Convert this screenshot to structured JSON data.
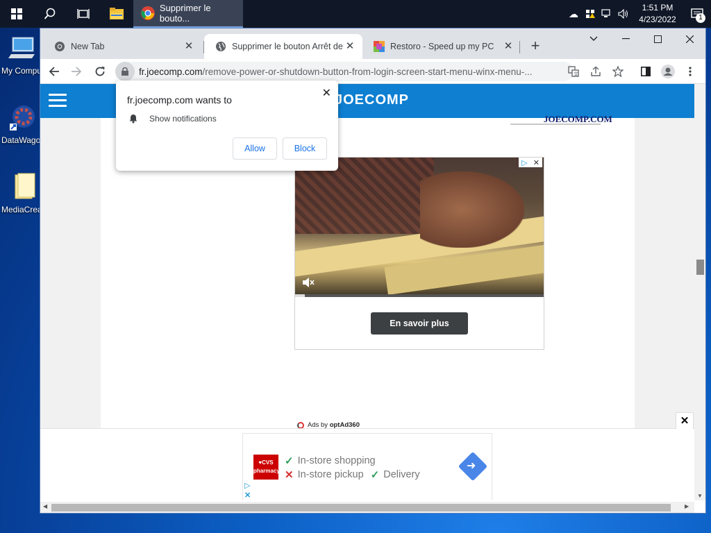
{
  "taskbar": {
    "active_app_title": "Supprimer le bouto...",
    "clock_time": "1:51 PM",
    "clock_date": "4/23/2022",
    "notification_count": "1"
  },
  "desktop": {
    "icons": [
      {
        "label": "My Computer"
      },
      {
        "label": "DataWagon"
      },
      {
        "label": "MediaCreation"
      }
    ]
  },
  "browser": {
    "tabs": [
      {
        "title": "New Tab"
      },
      {
        "title": "Supprimer le bouton Arrêt de"
      },
      {
        "title": "Restoro - Speed up my PC"
      }
    ],
    "url_domain": "fr.joecomp.com",
    "url_path": "/remove-power-or-shutdown-button-from-login-screen-start-menu-winx-menu-..."
  },
  "permission_prompt": {
    "title": "fr.joecomp.com wants to",
    "permission": "Show notifications",
    "allow_label": "Allow",
    "block_label": "Block"
  },
  "site": {
    "logo_text": "JOECOMP",
    "small_logo_text": "JOECOMP.COM"
  },
  "video_ad": {
    "cta_label": "En savoir plus",
    "progress": 0.04
  },
  "ads_by": {
    "prefix": "Ads by",
    "brand": "optAd360"
  },
  "bottom_ad": {
    "logo_text": "♥CVS pharmacy",
    "line1": "In-store shopping",
    "line2a": "In-store pickup",
    "line2b": "Delivery"
  },
  "colors": {
    "site_header": "#0e7fd1",
    "desktop_accent": "#0c5fc4",
    "cta_bg": "#3c4043"
  }
}
